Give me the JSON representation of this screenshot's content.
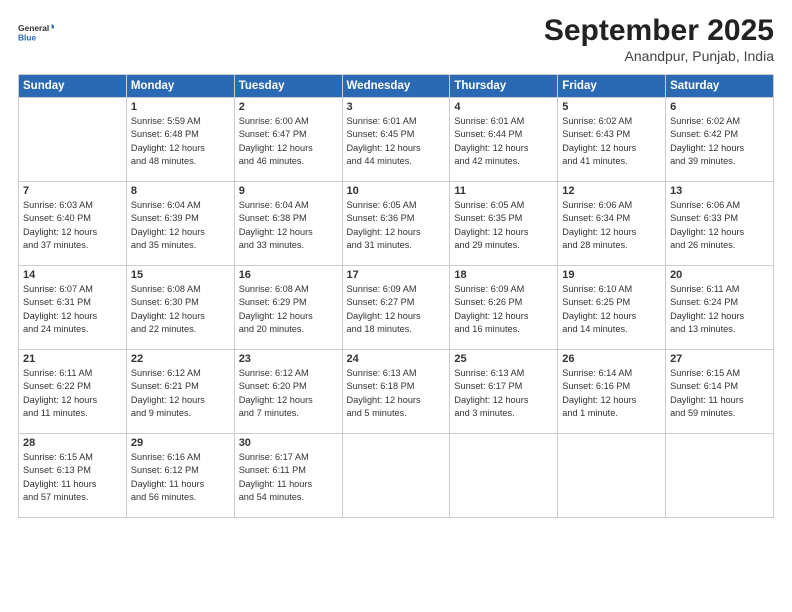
{
  "header": {
    "logo_general": "General",
    "logo_blue": "Blue",
    "title": "September 2025",
    "subtitle": "Anandpur, Punjab, India"
  },
  "weekdays": [
    "Sunday",
    "Monday",
    "Tuesday",
    "Wednesday",
    "Thursday",
    "Friday",
    "Saturday"
  ],
  "weeks": [
    [
      {
        "day": "",
        "info": ""
      },
      {
        "day": "1",
        "info": "Sunrise: 5:59 AM\nSunset: 6:48 PM\nDaylight: 12 hours\nand 48 minutes."
      },
      {
        "day": "2",
        "info": "Sunrise: 6:00 AM\nSunset: 6:47 PM\nDaylight: 12 hours\nand 46 minutes."
      },
      {
        "day": "3",
        "info": "Sunrise: 6:01 AM\nSunset: 6:45 PM\nDaylight: 12 hours\nand 44 minutes."
      },
      {
        "day": "4",
        "info": "Sunrise: 6:01 AM\nSunset: 6:44 PM\nDaylight: 12 hours\nand 42 minutes."
      },
      {
        "day": "5",
        "info": "Sunrise: 6:02 AM\nSunset: 6:43 PM\nDaylight: 12 hours\nand 41 minutes."
      },
      {
        "day": "6",
        "info": "Sunrise: 6:02 AM\nSunset: 6:42 PM\nDaylight: 12 hours\nand 39 minutes."
      }
    ],
    [
      {
        "day": "7",
        "info": "Sunrise: 6:03 AM\nSunset: 6:40 PM\nDaylight: 12 hours\nand 37 minutes."
      },
      {
        "day": "8",
        "info": "Sunrise: 6:04 AM\nSunset: 6:39 PM\nDaylight: 12 hours\nand 35 minutes."
      },
      {
        "day": "9",
        "info": "Sunrise: 6:04 AM\nSunset: 6:38 PM\nDaylight: 12 hours\nand 33 minutes."
      },
      {
        "day": "10",
        "info": "Sunrise: 6:05 AM\nSunset: 6:36 PM\nDaylight: 12 hours\nand 31 minutes."
      },
      {
        "day": "11",
        "info": "Sunrise: 6:05 AM\nSunset: 6:35 PM\nDaylight: 12 hours\nand 29 minutes."
      },
      {
        "day": "12",
        "info": "Sunrise: 6:06 AM\nSunset: 6:34 PM\nDaylight: 12 hours\nand 28 minutes."
      },
      {
        "day": "13",
        "info": "Sunrise: 6:06 AM\nSunset: 6:33 PM\nDaylight: 12 hours\nand 26 minutes."
      }
    ],
    [
      {
        "day": "14",
        "info": "Sunrise: 6:07 AM\nSunset: 6:31 PM\nDaylight: 12 hours\nand 24 minutes."
      },
      {
        "day": "15",
        "info": "Sunrise: 6:08 AM\nSunset: 6:30 PM\nDaylight: 12 hours\nand 22 minutes."
      },
      {
        "day": "16",
        "info": "Sunrise: 6:08 AM\nSunset: 6:29 PM\nDaylight: 12 hours\nand 20 minutes."
      },
      {
        "day": "17",
        "info": "Sunrise: 6:09 AM\nSunset: 6:27 PM\nDaylight: 12 hours\nand 18 minutes."
      },
      {
        "day": "18",
        "info": "Sunrise: 6:09 AM\nSunset: 6:26 PM\nDaylight: 12 hours\nand 16 minutes."
      },
      {
        "day": "19",
        "info": "Sunrise: 6:10 AM\nSunset: 6:25 PM\nDaylight: 12 hours\nand 14 minutes."
      },
      {
        "day": "20",
        "info": "Sunrise: 6:11 AM\nSunset: 6:24 PM\nDaylight: 12 hours\nand 13 minutes."
      }
    ],
    [
      {
        "day": "21",
        "info": "Sunrise: 6:11 AM\nSunset: 6:22 PM\nDaylight: 12 hours\nand 11 minutes."
      },
      {
        "day": "22",
        "info": "Sunrise: 6:12 AM\nSunset: 6:21 PM\nDaylight: 12 hours\nand 9 minutes."
      },
      {
        "day": "23",
        "info": "Sunrise: 6:12 AM\nSunset: 6:20 PM\nDaylight: 12 hours\nand 7 minutes."
      },
      {
        "day": "24",
        "info": "Sunrise: 6:13 AM\nSunset: 6:18 PM\nDaylight: 12 hours\nand 5 minutes."
      },
      {
        "day": "25",
        "info": "Sunrise: 6:13 AM\nSunset: 6:17 PM\nDaylight: 12 hours\nand 3 minutes."
      },
      {
        "day": "26",
        "info": "Sunrise: 6:14 AM\nSunset: 6:16 PM\nDaylight: 12 hours\nand 1 minute."
      },
      {
        "day": "27",
        "info": "Sunrise: 6:15 AM\nSunset: 6:14 PM\nDaylight: 11 hours\nand 59 minutes."
      }
    ],
    [
      {
        "day": "28",
        "info": "Sunrise: 6:15 AM\nSunset: 6:13 PM\nDaylight: 11 hours\nand 57 minutes."
      },
      {
        "day": "29",
        "info": "Sunrise: 6:16 AM\nSunset: 6:12 PM\nDaylight: 11 hours\nand 56 minutes."
      },
      {
        "day": "30",
        "info": "Sunrise: 6:17 AM\nSunset: 6:11 PM\nDaylight: 11 hours\nand 54 minutes."
      },
      {
        "day": "",
        "info": ""
      },
      {
        "day": "",
        "info": ""
      },
      {
        "day": "",
        "info": ""
      },
      {
        "day": "",
        "info": ""
      }
    ]
  ]
}
